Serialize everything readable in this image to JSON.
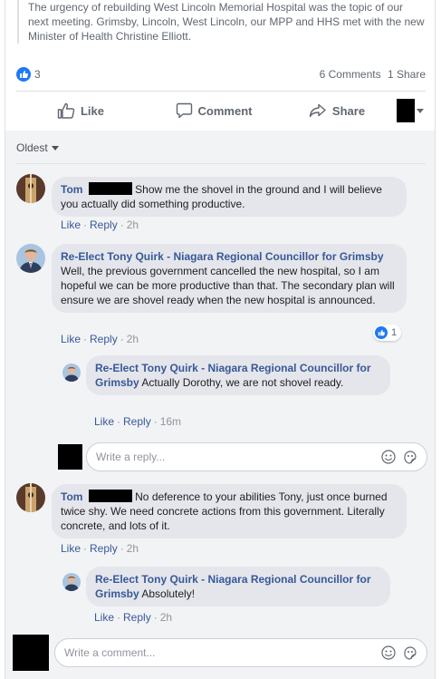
{
  "post": {
    "excerpt": "The urgency of rebuilding West Lincoln Memorial Hospital was the topic of our next meeting. Grimsby, Lincoln, West Lincoln, our MPP and HHS met with the new Minister of Health Christine Elliott.",
    "like_count": "3",
    "comments_count": "6 Comments",
    "shares_count": "1 Share"
  },
  "actions": {
    "like": "Like",
    "comment": "Comment",
    "share": "Share"
  },
  "sort_label": "Oldest",
  "comments": [
    {
      "author": "Tom",
      "text": "Show me the shovel in the ground and I will believe you actually did something productive.",
      "like": "Like",
      "reply": "Reply",
      "time": "2h"
    },
    {
      "author": "Re-Elect Tony Quirk - Niagara Regional Councillor for Grimsby",
      "text": "Well, the previous government cancelled the new hospital, so I am hopeful we can be more productive than that. The secondary plan will ensure we are shovel ready when the new hospital is announced.",
      "like": "Like",
      "reply": "Reply",
      "time": "2h",
      "reaction_count": "1",
      "replies": [
        {
          "author": "Re-Elect Tony Quirk - Niagara Regional Councillor for Grimsby",
          "text": "Actually Dorothy, we are not shovel ready.",
          "like": "Like",
          "reply": "Reply",
          "time": "16m"
        }
      ],
      "reply_placeholder": "Write a reply..."
    },
    {
      "author": "Tom",
      "text": "No deference to your abilities Tony, just once burned twice shy. We need concrete actions from this government. Literally concrete, and lots of it.",
      "like": "Like",
      "reply": "Reply",
      "time": "2h",
      "replies": [
        {
          "author": "Re-Elect Tony Quirk - Niagara Regional Councillor for Grimsby",
          "text": "Absolutely!",
          "like": "Like",
          "reply": "Reply",
          "time": "2h"
        }
      ]
    }
  ],
  "comment_placeholder": "Write a comment...",
  "colors": {
    "link": "#385898",
    "like_blue": "#2078f4",
    "bubble": "#e4e6eb",
    "muted": "#606770"
  }
}
